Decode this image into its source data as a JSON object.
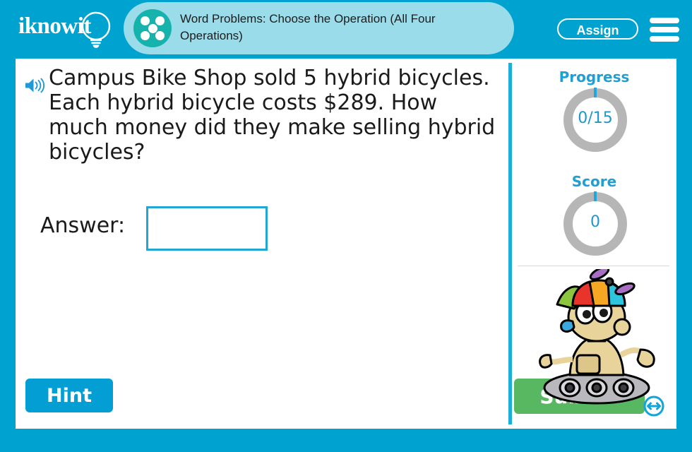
{
  "brand": {
    "logo_text": "iknowit",
    "logo_icon": "lightbulb-icon"
  },
  "header": {
    "title": "Word Problems: Choose the Operation (All Four Operations)",
    "title_icon": "dice-five-icon",
    "assign_label": "Assign",
    "menu_icon": "hamburger-menu-icon",
    "band_color": "#9bdcea",
    "bar_color": "#00a3d0"
  },
  "question": {
    "audio_icon": "speaker-icon",
    "text": "Campus Bike Shop sold 5 hybrid bicycles. Each hybrid bicycle costs $289. How much money did they make selling hybrid bicycles?"
  },
  "answer": {
    "label": "Answer:",
    "value": "",
    "placeholder": ""
  },
  "actions": {
    "hint_label": "Hint",
    "hint_color": "#039ed3",
    "submit_label": "Submit",
    "submit_color": "#58b862"
  },
  "sidebar": {
    "progress": {
      "label": "Progress",
      "value": "0/15"
    },
    "score": {
      "label": "Score",
      "value": "0"
    },
    "ring_color": "#b6b6b6",
    "accent_color": "#1fa8dc",
    "mascot_icon": "robot-mascot-icon",
    "resize_icon": "resize-horizontal-icon"
  }
}
